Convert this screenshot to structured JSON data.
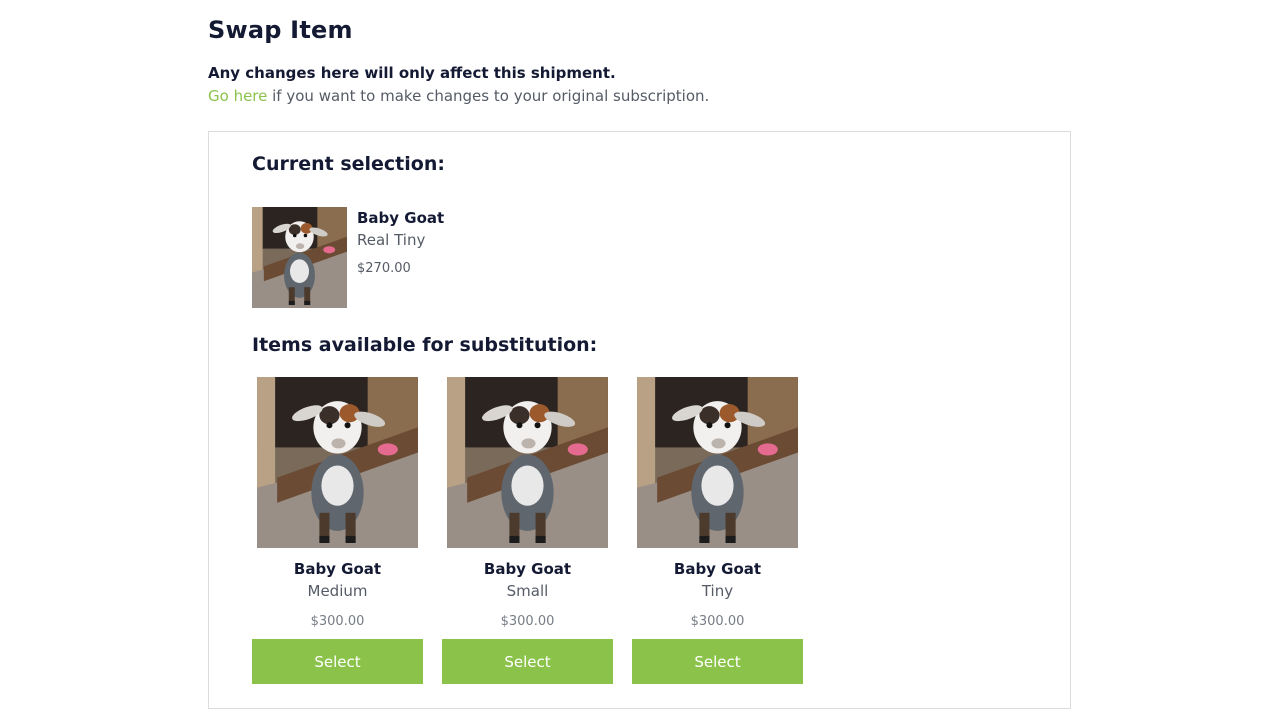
{
  "header": {
    "title": "Swap Item",
    "notice_bold": "Any changes here will only affect this shipment.",
    "notice_link": "Go here",
    "notice_rest": " if you want to make changes to your original subscription."
  },
  "current": {
    "heading": "Current selection:",
    "name": "Baby Goat",
    "variant": "Real Tiny",
    "price": "$270.00",
    "image": "baby-goat-photo"
  },
  "substitutions": {
    "heading": "Items available for substitution:",
    "items": [
      {
        "name": "Baby Goat",
        "variant": "Medium",
        "price": "$300.00",
        "button": "Select",
        "image": "baby-goat-photo"
      },
      {
        "name": "Baby Goat",
        "variant": "Small",
        "price": "$300.00",
        "button": "Select",
        "image": "baby-goat-photo"
      },
      {
        "name": "Baby Goat",
        "variant": "Tiny",
        "price": "$300.00",
        "button": "Select",
        "image": "baby-goat-photo"
      }
    ]
  },
  "colors": {
    "accent": "#8bc34a",
    "heading": "#141a33",
    "muted": "#555b66"
  }
}
